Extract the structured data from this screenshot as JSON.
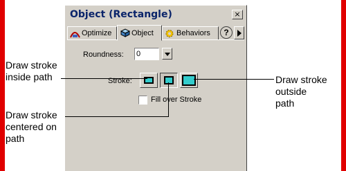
{
  "panel": {
    "title": "Object (Rectangle)",
    "close_label": "×",
    "tabs": [
      {
        "label": "Optimize",
        "icon": "optimize-icon"
      },
      {
        "label": "Object",
        "icon": "object-cube-icon"
      },
      {
        "label": "Behaviors",
        "icon": "behaviors-gear-icon"
      }
    ],
    "help_label": "?",
    "roundness": {
      "label": "Roundness:",
      "value": "0"
    },
    "stroke": {
      "label": "Stroke:",
      "options": [
        "inside",
        "centered",
        "outside"
      ],
      "selected": "centered"
    },
    "fill_over_stroke": {
      "label": "Fill over Stroke",
      "checked": false
    }
  },
  "colors": {
    "accent_red": "#e00000",
    "swatch_cyan": "#33cccc",
    "panel_bg": "#d4d0c8",
    "title_blue": "#0a246a"
  },
  "callouts": {
    "inside": [
      "Draw stroke",
      "inside path"
    ],
    "centered": [
      "Draw stroke",
      "centered on",
      "path"
    ],
    "outside": [
      "Draw stroke",
      "outside",
      "path"
    ]
  }
}
